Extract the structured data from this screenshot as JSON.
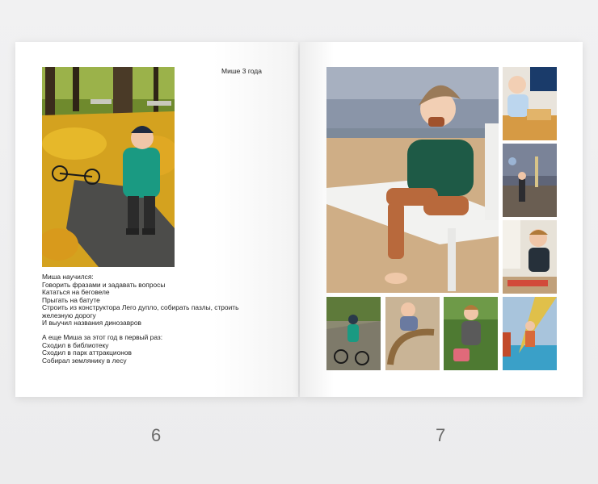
{
  "left_page": {
    "title": "Мише 3 года",
    "learned": [
      "Миша научился:",
      "Говорить фразами и задавать вопросы",
      "Кататься на беговеле",
      "Прыгать на батуте",
      "Строить из конструктора Лего дупло, собирать пазлы, строить",
      "железную дорогу",
      "И выучил названия динозавров"
    ],
    "firsts": [
      "А еще Миша за этот год в первый раз:",
      "Сходил в библиотеку",
      "Сходил в парк аттракционов",
      "Собирал землянику в лесу"
    ]
  },
  "page_numbers": {
    "left": "6",
    "right": "7"
  }
}
